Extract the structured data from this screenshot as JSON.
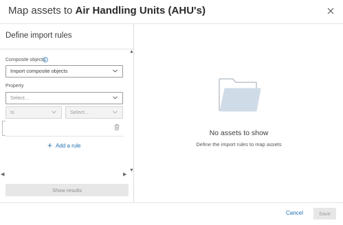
{
  "dialog": {
    "title_prefix": "Map assets to ",
    "title_bold": "Air Handling Units (AHU's)",
    "close_icon": "close-icon"
  },
  "left_panel": {
    "section_title": "Define import rules",
    "composite": {
      "label": "Composite objects",
      "value": "Import composite objects"
    },
    "property": {
      "label": "Property",
      "placeholder": "Select..."
    },
    "condition": {
      "operator": "Is",
      "value_placeholder": "Select..."
    },
    "add_rule_label": "Add a rule",
    "show_results_label": "Show results"
  },
  "right_panel": {
    "empty_title": "No assets to show",
    "empty_subtitle": "Define the import rules to map assets",
    "folder_icon": "folder-icon"
  },
  "footer": {
    "cancel_label": "Cancel",
    "save_label": "Save"
  },
  "colors": {
    "accent": "#1f6fb2",
    "folder_fill": "#cfdbe6",
    "disabled_bg": "#e7e7e7"
  }
}
